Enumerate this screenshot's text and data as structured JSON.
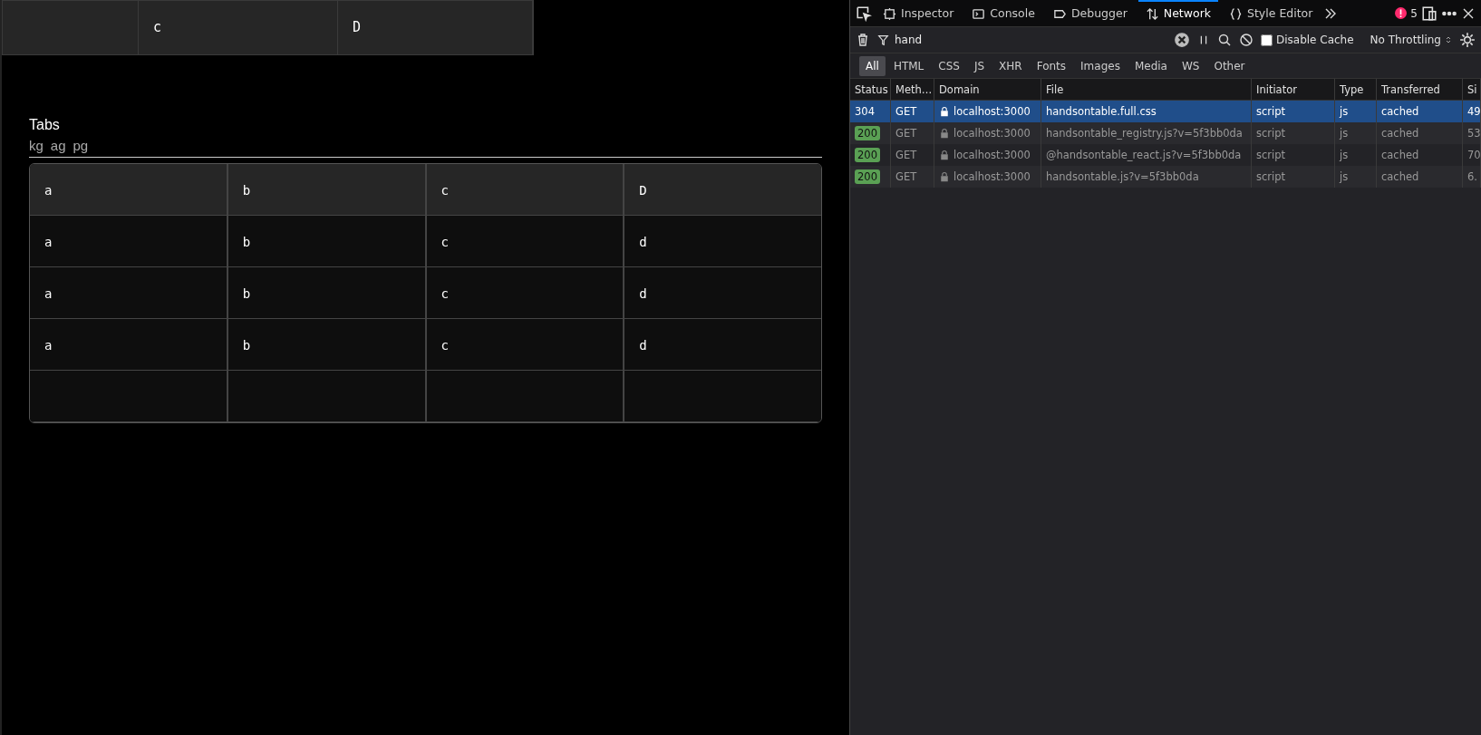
{
  "page": {
    "sticky_header": [
      "c",
      "D"
    ],
    "tabs_label": "Tabs",
    "tabs": [
      {
        "label": "kg",
        "selected": false
      },
      {
        "label": "ag",
        "selected": false
      },
      {
        "label": "pg",
        "selected": false
      }
    ],
    "table": {
      "columns": [
        "a",
        "b",
        "c",
        "D"
      ],
      "rows": [
        [
          "a",
          "b",
          "c",
          "d"
        ],
        [
          "a",
          "b",
          "c",
          "d"
        ],
        [
          "a",
          "b",
          "c",
          "d"
        ],
        [
          null,
          null,
          null,
          null
        ]
      ]
    }
  },
  "devtools": {
    "tabs": [
      {
        "label": "Inspector",
        "selected": false
      },
      {
        "label": "Console",
        "selected": false
      },
      {
        "label": "Debugger",
        "selected": false
      },
      {
        "label": "Network",
        "selected": true
      },
      {
        "label": "Style Editor",
        "selected": false
      }
    ],
    "error_count": "5",
    "filter": {
      "value": "hand"
    },
    "disable_cache": {
      "label": "Disable Cache",
      "checked": false
    },
    "throttling": "No Throttling",
    "type_filters": [
      {
        "label": "All",
        "selected": true
      },
      {
        "label": "HTML",
        "selected": false
      },
      {
        "label": "CSS",
        "selected": false
      },
      {
        "label": "JS",
        "selected": false
      },
      {
        "label": "XHR",
        "selected": false
      },
      {
        "label": "Fonts",
        "selected": false
      },
      {
        "label": "Images",
        "selected": false
      },
      {
        "label": "Media",
        "selected": false
      },
      {
        "label": "WS",
        "selected": false
      },
      {
        "label": "Other",
        "selected": false
      }
    ],
    "columns": [
      "Status",
      "Meth…",
      "Domain",
      "File",
      "Initiator",
      "Type",
      "Transferred",
      "Si"
    ],
    "requests": [
      {
        "status": "304",
        "method": "GET",
        "domain": "localhost:3000",
        "file": "handsontable.full.css",
        "initiator": "script",
        "type": "js",
        "transferred": "cached",
        "size": "49",
        "selected": true
      },
      {
        "status": "200",
        "method": "GET",
        "domain": "localhost:3000",
        "file": "handsontable_registry.js?v=5f3bb0da",
        "initiator": "script",
        "type": "js",
        "transferred": "cached",
        "size": "53",
        "selected": false
      },
      {
        "status": "200",
        "method": "GET",
        "domain": "localhost:3000",
        "file": "@handsontable_react.js?v=5f3bb0da",
        "initiator": "script",
        "type": "js",
        "transferred": "cached",
        "size": "70",
        "selected": false
      },
      {
        "status": "200",
        "method": "GET",
        "domain": "localhost:3000",
        "file": "handsontable.js?v=5f3bb0da",
        "initiator": "script",
        "type": "js",
        "transferred": "cached",
        "size": "6.",
        "selected": false
      }
    ]
  }
}
